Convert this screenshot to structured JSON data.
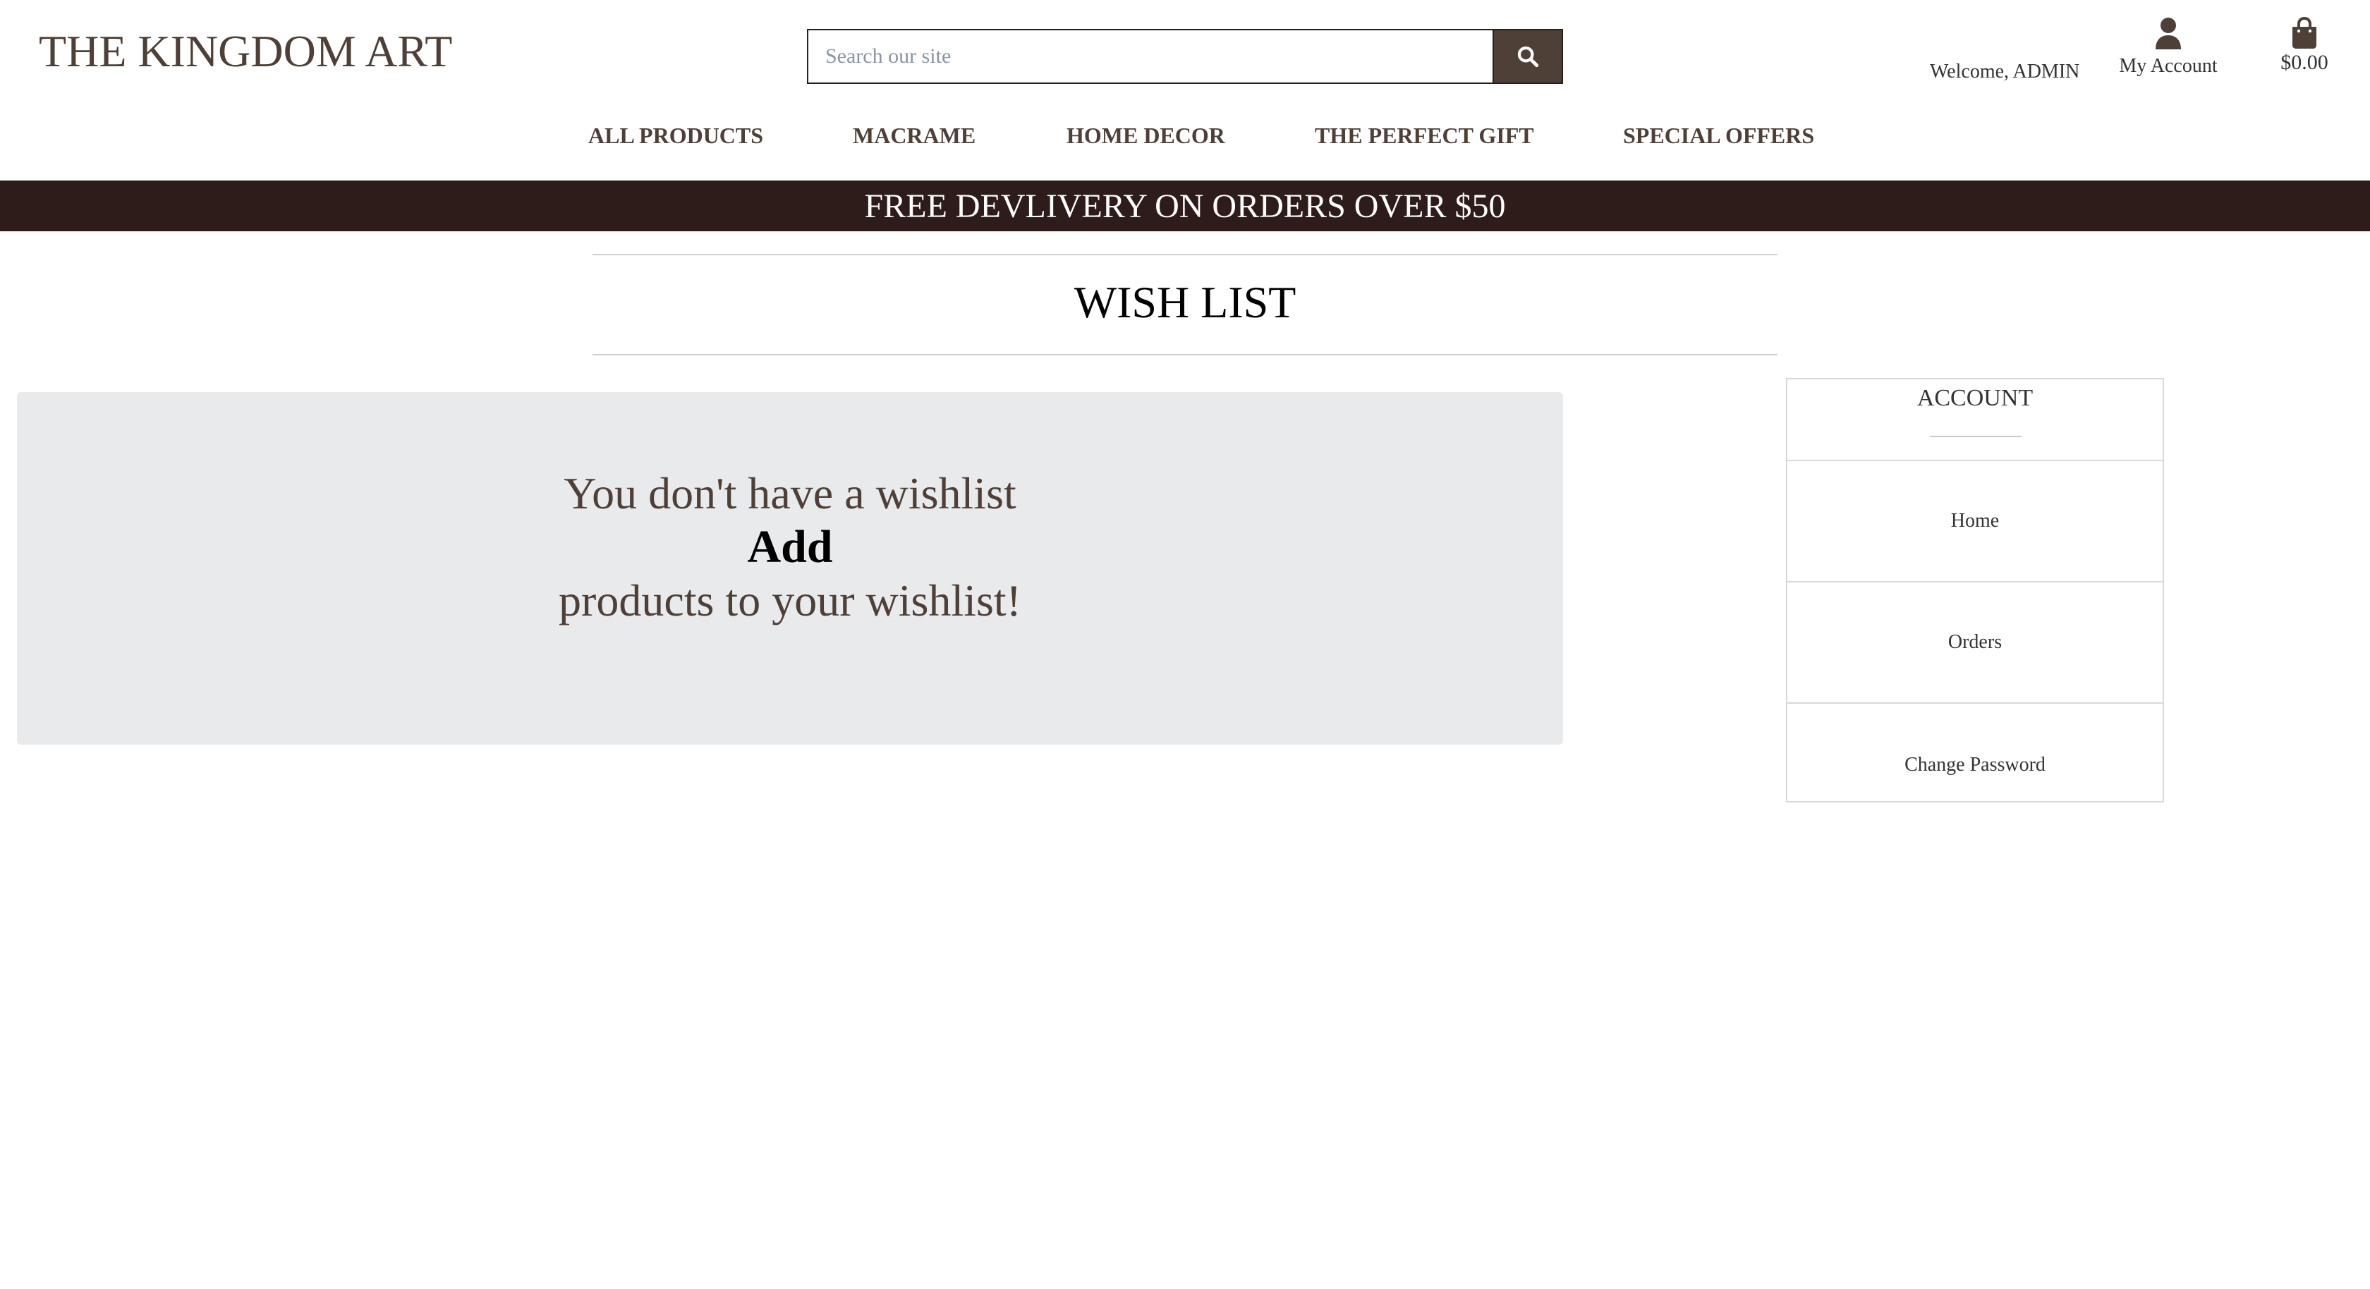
{
  "header": {
    "logo": "THE KINGDOM ART",
    "search": {
      "placeholder": "Search our site",
      "value": ""
    },
    "welcome_text": "Welcome, ADMIN",
    "account_label": "My Account",
    "cart_total": "$0.00",
    "icons": {
      "search": "search-icon",
      "account": "user-icon",
      "cart": "shopping-bag-icon"
    }
  },
  "nav": {
    "items": [
      {
        "label": "ALL PRODUCTS"
      },
      {
        "label": "MACRAME"
      },
      {
        "label": "HOME DECOR"
      },
      {
        "label": "THE PERFECT GIFT"
      },
      {
        "label": "SPECIAL OFFERS"
      }
    ]
  },
  "banner": {
    "text": "FREE DEVLIVERY ON ORDERS OVER $50"
  },
  "page": {
    "title": "WISH LIST"
  },
  "wishlist": {
    "line1": "You don't have a wishlist",
    "add_link": "Add",
    "line2": "products to your wishlist!"
  },
  "account_panel": {
    "title": "ACCOUNT",
    "items": [
      {
        "label": "Home"
      },
      {
        "label": "Orders"
      },
      {
        "label": "Change Password"
      }
    ]
  },
  "colors": {
    "brand_brown": "#4e3f37",
    "banner_bg": "#2d1c19",
    "empty_box_bg": "#e9eaec"
  }
}
